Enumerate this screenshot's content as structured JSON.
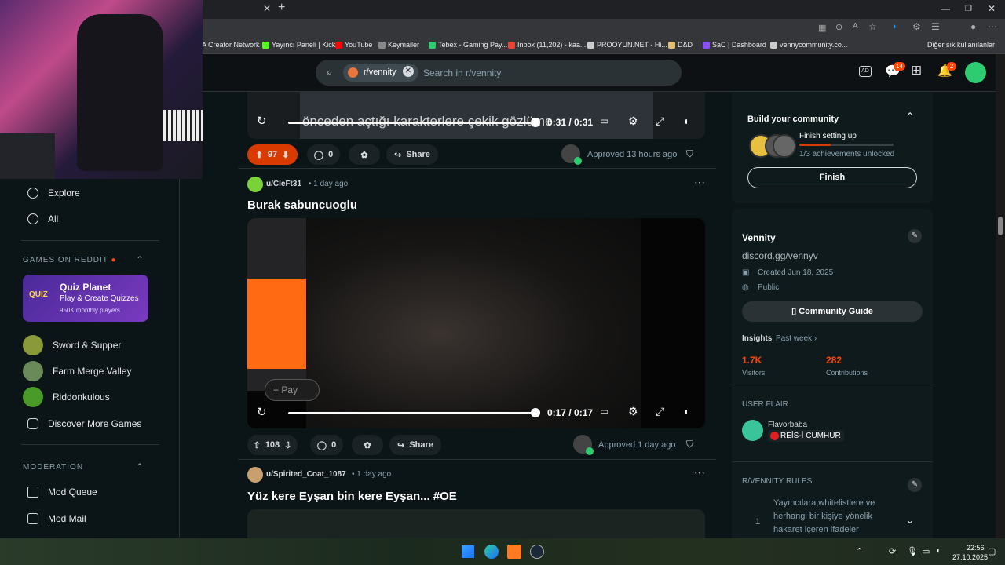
{
  "browser": {
    "bookmarks": [
      {
        "label": "A Creator Network",
        "color": "#4a90d9"
      },
      {
        "label": "Yayıncı Paneli | Kick",
        "color": "#53fc18"
      },
      {
        "label": "YouTube",
        "color": "#ff0000"
      },
      {
        "label": "Keymailer",
        "color": "#888888"
      },
      {
        "label": "Tebex - Gaming Pay...",
        "color": "#2ecc71"
      },
      {
        "label": "Inbox (11,202) - kaa...",
        "color": "#ea4335"
      },
      {
        "label": "PROOYUN.NET - Hi...",
        "color": "#cccccc"
      },
      {
        "label": "D&D",
        "color": "#e0c070"
      },
      {
        "label": "SaC | Dashboard",
        "color": "#8a4fff"
      },
      {
        "label": "vennycommunity.co...",
        "color": "#cccccc"
      }
    ],
    "other_bookmarks": "Diğer sık kullanılanlar"
  },
  "header": {
    "community_chip": "r/vennity",
    "search_placeholder": "Search in r/vennity",
    "chat_badge": "14",
    "notif_badge": "2"
  },
  "sidebar": {
    "nav": [
      {
        "label": "Explore",
        "icon": "explore-icon"
      },
      {
        "label": "All",
        "icon": "all-icon"
      }
    ],
    "games_header": "GAMES ON REDDIT",
    "featured_game": {
      "title": "Quiz Planet",
      "subtitle": "Play & Create Quizzes",
      "players": "950K monthly players",
      "badge": "QUIZ"
    },
    "games": [
      "Sword & Supper",
      "Farm Merge Valley",
      "Riddonkulous",
      "Discover More Games"
    ],
    "moderation_header": "MODERATION",
    "moderation": [
      "Mod Queue",
      "Mod Mail"
    ]
  },
  "posts": [
    {
      "video_subtitle": "önceden açtığı karakterlere çekik gözlüme",
      "time": "0:31 / 0:31",
      "votes": "97",
      "comments": "0",
      "share": "Share",
      "approved": "Approved 13 hours ago"
    },
    {
      "author": "u/CleFt31",
      "age": "• 1 day ago",
      "title": "Burak sabuncuoglu",
      "time": "0:17 / 0:17",
      "votes": "108",
      "comments": "0",
      "share": "Share",
      "approved": "Approved 1 day ago",
      "video_overlay_text": "+ Pay"
    },
    {
      "author": "u/Spirited_Coat_1087",
      "age": "• 1 day ago",
      "title": "Yüz kere Eyşan bin kere Eyşan... #OE"
    }
  ],
  "right": {
    "build": {
      "title": "Build your community",
      "step": "Finish setting up",
      "progress_label": "1/3 achievements unlocked",
      "progress": 0.33,
      "button": "Finish"
    },
    "about": {
      "name": "Vennity",
      "link": "discord.gg/vennyv",
      "created": "Created Jun 18, 2025",
      "visibility": "Public",
      "guide_button": "Community Guide",
      "insights": "Insights",
      "insights_period": "Past week ›",
      "visitors_value": "1.7K",
      "visitors_label": "Visitors",
      "contrib_value": "282",
      "contrib_label": "Contributions",
      "flair_header": "USER FLAIR",
      "flair_user": "Flavorbaba",
      "flair_tag": "REİS-İ CUMHUR",
      "rules_header": "R/VENNITY RULES",
      "rule_number": "1",
      "rule_text": "Yayıncılara,whitelistlere ve herhangi bir kişiye yönelik hakaret içeren ifadeler"
    }
  },
  "taskbar": {
    "time": "22:56",
    "date": "27.10.2025"
  },
  "colors": {
    "upvote_active": "#d93a00",
    "accent": "#ff4500",
    "progress": "#d93a00"
  }
}
